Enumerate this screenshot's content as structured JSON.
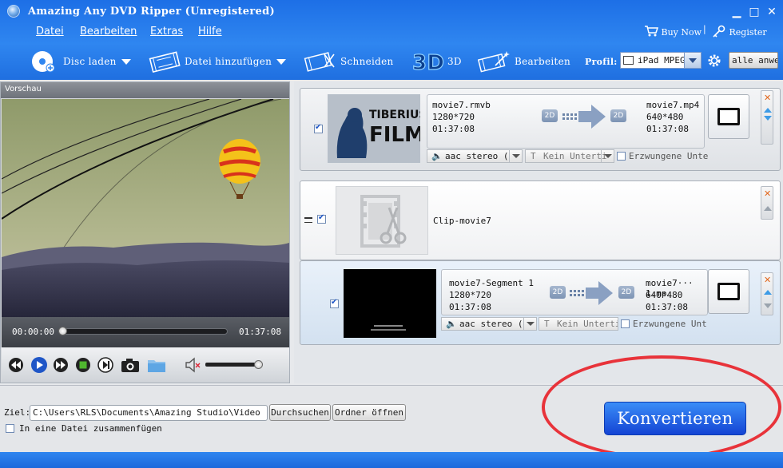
{
  "window": {
    "title": "Amazing Any DVD Ripper (Unregistered)"
  },
  "menu": [
    "Datei",
    "Bearbeiten",
    "Extras",
    "Hilfe"
  ],
  "top_right": {
    "buy_now": "Buy Now",
    "register": "Register"
  },
  "toolbar": {
    "load_disc": "Disc laden",
    "add_file": "Datei hinzufügen",
    "cut": "Schneiden",
    "three_d": "3D",
    "edit": "Bearbeiten",
    "profile_label": "Profil:",
    "profile_value": "iPad MPEG",
    "apply_all": "alle anwe"
  },
  "preview": {
    "header": "Vorschau",
    "time_current": "00:00:00",
    "time_total": "01:37:08"
  },
  "items": [
    {
      "thumb_text_top": "TIBERIUS",
      "thumb_text_bottom": "FILM",
      "source_name": "movie7.rmvb",
      "source_res": "1280*720",
      "source_dur": "01:37:08",
      "badge_in": "2D",
      "badge_out": "2D",
      "target_name": "movie7.mp4",
      "target_res": "640*480",
      "target_dur": "01:37:08",
      "audio": "aac stereo (",
      "subtitle": "Kein Unterti",
      "forced": "Erzwungene Unte"
    },
    {
      "clip_name": "Clip-movie7"
    },
    {
      "source_name": "movie7-Segment 1",
      "source_res": "1280*720",
      "source_dur": "01:37:08",
      "badge_in": "2D",
      "badge_out": "2D",
      "target_name": "movie7··· 1.mp",
      "target_res": "640*480",
      "target_dur": "01:37:08",
      "audio": "aac stereo (",
      "subtitle": "Kein Unterti",
      "forced": "Erzwungene Unt"
    }
  ],
  "bottom": {
    "dest_label": "Ziel:",
    "dest_path": "C:\\Users\\RLS\\Documents\\Amazing Studio\\Video",
    "browse": "Durchsuchen",
    "open_folder": "Ordner öffnen",
    "merge_label": "In eine Datei zusammenfügen",
    "convert": "Konvertieren"
  },
  "colors": {
    "accent_blue": "#2f86f0",
    "convert_blue": "#1f5fe6",
    "highlight_red": "#e8333a"
  }
}
